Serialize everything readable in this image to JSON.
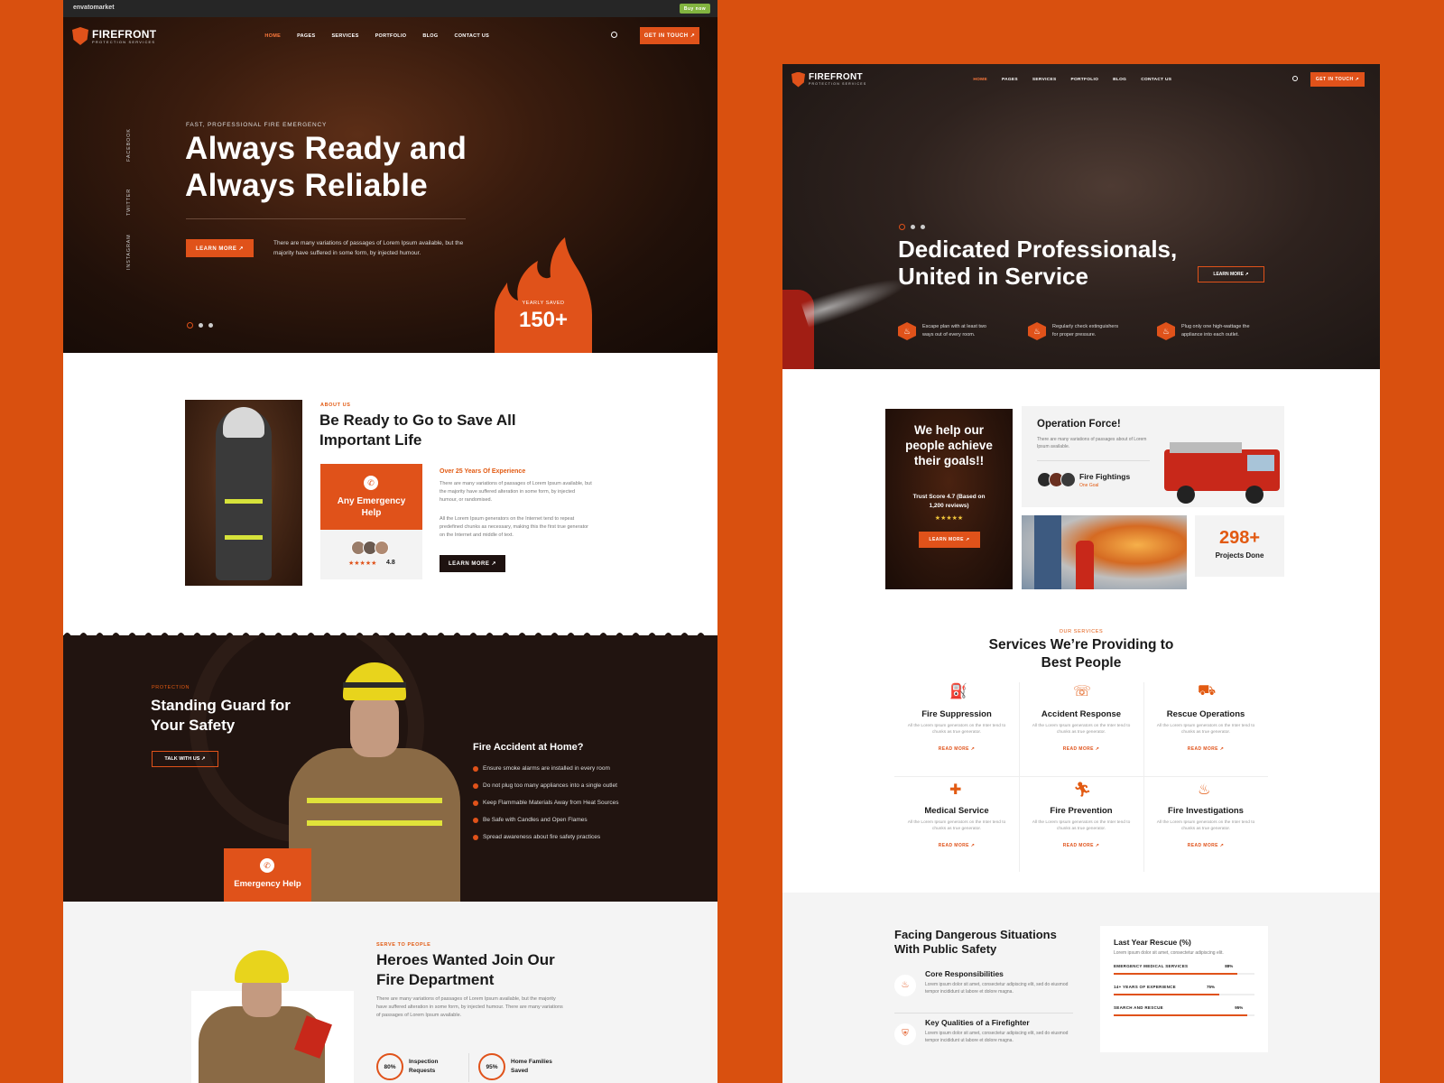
{
  "envato": {
    "brand": "envatomarket",
    "buy": "Buy now"
  },
  "brand": {
    "name": "FIREFRONT",
    "sub": "PROTECTION SERVICES"
  },
  "nav": {
    "items": [
      "HOME",
      "PAGES",
      "SERVICES",
      "PORTFOLIO",
      "BLOG",
      "CONTACT US"
    ],
    "cta": "GET IN TOUCH ↗"
  },
  "left": {
    "hero": {
      "eyebrow": "FAST, PROFESSIONAL FIRE EMERGENCY",
      "title1": "Always Ready and",
      "title2": "Always Reliable",
      "btn": "LEARN MORE ↗",
      "desc": "There are many variations of passages of Lorem Ipsum available, but the majority have suffered in some form, by injected humour.",
      "social": [
        "FACEBOOK",
        "TWITTER",
        "INSTAGRAM"
      ],
      "badge_label": "YEARLY SAVED",
      "badge_value": "150+"
    },
    "about": {
      "eyebrow": "ABOUT US",
      "title1": "Be Ready to Go to Save All",
      "title2": "Important Life",
      "card_title": "Any Emergency Help",
      "rating": "4.8",
      "exp": "Over 25 Years Of Experience",
      "p1": "There are many variations of passages of Lorem Ipsum available, but the majority have suffered alteration in some form, by injected humour, or randomised.",
      "p2": "All the Lorem Ipsum generators on the Internet tend to repeat predefined chunks as necessary, making this the first true generator on the Internet and middle of text.",
      "btn": "LEARN MORE ↗"
    },
    "protection": {
      "eyebrow": "PROTECTION",
      "title1": "Standing Guard for",
      "title2": "Your Safety",
      "btn": "TALK WITH US ↗",
      "emergency": "Emergency Help",
      "list_title": "Fire Accident at Home?",
      "list": [
        "Ensure smoke alarms are installed in every room",
        "Do not plug too many appliances into a single outlet",
        "Keep Flammable Materials Away from Heat Sources",
        "Be Safe with Candles and Open Flames",
        "Spread awareness about fire safety practices"
      ]
    },
    "heroes": {
      "eyebrow": "SERVE TO PEOPLE",
      "title1": "Heroes Wanted Join Our",
      "title2": "Fire Department",
      "desc": "There are many variations of passages of Lorem Ipsum available, but the majority have suffered alteration in some form, by injected humour. There are many variations of passages of Lorem Ipsum available.",
      "stats": [
        {
          "pct": "80%",
          "label1": "Inspection",
          "label2": "Requests"
        },
        {
          "pct": "95%",
          "label1": "Home Families",
          "label2": "Saved"
        }
      ]
    }
  },
  "right": {
    "hero": {
      "title1": "Dedicated Professionals,",
      "title2": "United in Service",
      "btn": "LEARN MORE ↗",
      "tips": [
        {
          "l1": "Escape plan with at least two",
          "l2": "ways out of every room."
        },
        {
          "l1": "Regularly check extinguishers",
          "l2": "for proper pressure."
        },
        {
          "l1": "Plug only one high-wattage the",
          "l2": "appliance into each outlet."
        }
      ]
    },
    "goals": {
      "title1": "We help our",
      "title2": "people achieve",
      "title3": "their goals!!",
      "trust1": "Trust Score 4.7 (Based on",
      "trust2": "1,200 reviews)",
      "btn": "LEARN MORE ↗",
      "op_title": "Operation Force!",
      "op_desc": "There are many variations of passages about of Lorem Ipsum available.",
      "ff_title": "Fire Fightings",
      "ff_sub": "One Goal",
      "projects_value": "298+",
      "projects_label": "Projects Done"
    },
    "services": {
      "eyebrow": "OUR SERVICES",
      "title1": "Services We’re Providing to",
      "title2": "Best People",
      "desc": "All the Lorem Ipsum generators on the Inter tend to chunks as true generator.",
      "more": "READ MORE ↗",
      "items": [
        "Fire Suppression",
        "Accident Response",
        "Rescue Operations",
        "Medical Service",
        "Fire Prevention",
        "Fire Investigations"
      ]
    },
    "safety": {
      "title1": "Facing Dangerous Situations",
      "title2": "With Public Safety",
      "items": [
        {
          "title": "Core Responsibilities",
          "desc": "Lorem ipsum dolor sit amet, consectetur adipiscing elit, sed do eiusmod tempor incididunt ut labore et dolore magna."
        },
        {
          "title": "Key Qualities of a Firefighter",
          "desc": "Lorem ipsum dolor sit amet, consectetur adipiscing elit, sed do eiusmod tempor incididunt ut labore et dolore magna."
        }
      ],
      "rescue_title": "Last Year Rescue (%)",
      "rescue_desc": "Lorem ipsum dolor sit amet, consectetur adipiscing elit.",
      "bars": [
        {
          "label": "EMERGENCY MEDICAL SERVICES",
          "value": 88,
          "text": "88%"
        },
        {
          "label": "14+ YEARS OF EXPERIENCE",
          "value": 75,
          "text": "75%"
        },
        {
          "label": "SEARCH AND RESCUE",
          "value": 95,
          "text": "95%"
        }
      ]
    }
  }
}
